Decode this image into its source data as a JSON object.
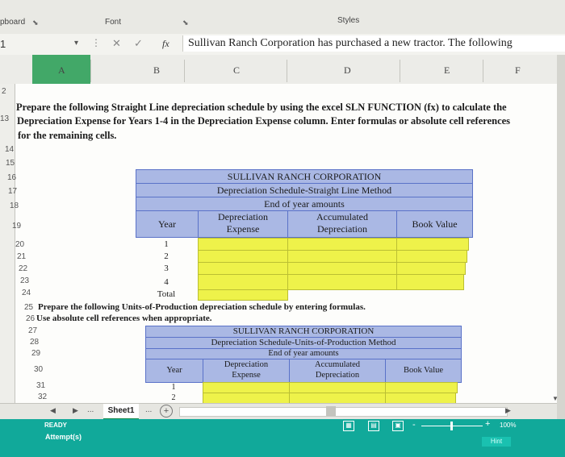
{
  "ribbon": {
    "clipboard": "pboard",
    "font": "Font",
    "styles": "Styles"
  },
  "formula_bar": {
    "name_box": "1",
    "cancel": "✕",
    "enter": "✓",
    "fx": "fx",
    "formula": "Sullivan Ranch Corporation has purchased a new tractor. The following"
  },
  "columns": [
    "A",
    "B",
    "C",
    "D",
    "E",
    "F"
  ],
  "rows": {
    "r12": "2",
    "r13": "13",
    "r14": "14",
    "r15": "15",
    "r16": "16",
    "r17": "17",
    "r18": "18",
    "r19": "19",
    "r20": "20",
    "r21": "21",
    "r22": "22",
    "r23": "23",
    "r24": "24",
    "r25": "25",
    "r26": "26",
    "r27": "27",
    "r28": "28",
    "r29": "29",
    "r30": "30",
    "r31": "31",
    "r32": "32"
  },
  "instructions": {
    "sln_line1": "Prepare the following Straight Line depreciation schedule by using the excel SLN FUNCTION (fx) to calculate the",
    "sln_line2": "Depreciation Expense for Years 1-4 in the Depreciation Expense column. Enter formulas or absolute cell references",
    "sln_line3": "for the remaining cells.",
    "uop_line1": "Prepare the following Units-of-Production depreciation schedule by entering formulas.",
    "uop_line2": "Use absolute cell references when appropriate."
  },
  "table_sl": {
    "title": "SULLIVAN RANCH CORPORATION",
    "subtitle": "Depreciation Schedule-Straight Line Method",
    "note": "End of year amounts",
    "col_year": "Year",
    "col_dep_exp_1": "Depreciation",
    "col_dep_exp_2": "Expense",
    "col_acc_dep_1": "Accumulated",
    "col_acc_dep_2": "Depreciation",
    "col_book": "Book Value",
    "years": [
      "1",
      "2",
      "3",
      "4"
    ],
    "total": "Total"
  },
  "table_uop": {
    "title": "SULLIVAN RANCH CORPORATION",
    "subtitle": "Depreciation Schedule-Units-of-Production Method",
    "note": "End of year amounts",
    "col_year": "Year",
    "col_dep_exp_1": "Depreciation",
    "col_dep_exp_2": "Expense",
    "col_acc_dep_1": "Accumulated",
    "col_acc_dep_2": "Depreciation",
    "col_book": "Book Value",
    "years": [
      "1",
      "2"
    ]
  },
  "tabs": {
    "ellipsis": "...",
    "sheet": "Sheet1",
    "ellipsis2": "...",
    "add": "+"
  },
  "status": {
    "ready": "READY",
    "attempts": "Attempt(s)",
    "zoom": "100%",
    "hint": "Hint",
    "minus": "-",
    "plus": "+"
  },
  "colors": {
    "accent_green": "#42a868",
    "status_teal": "#11a99a",
    "header_blue": "#aab8e4",
    "input_yellow": "#eef24a"
  }
}
